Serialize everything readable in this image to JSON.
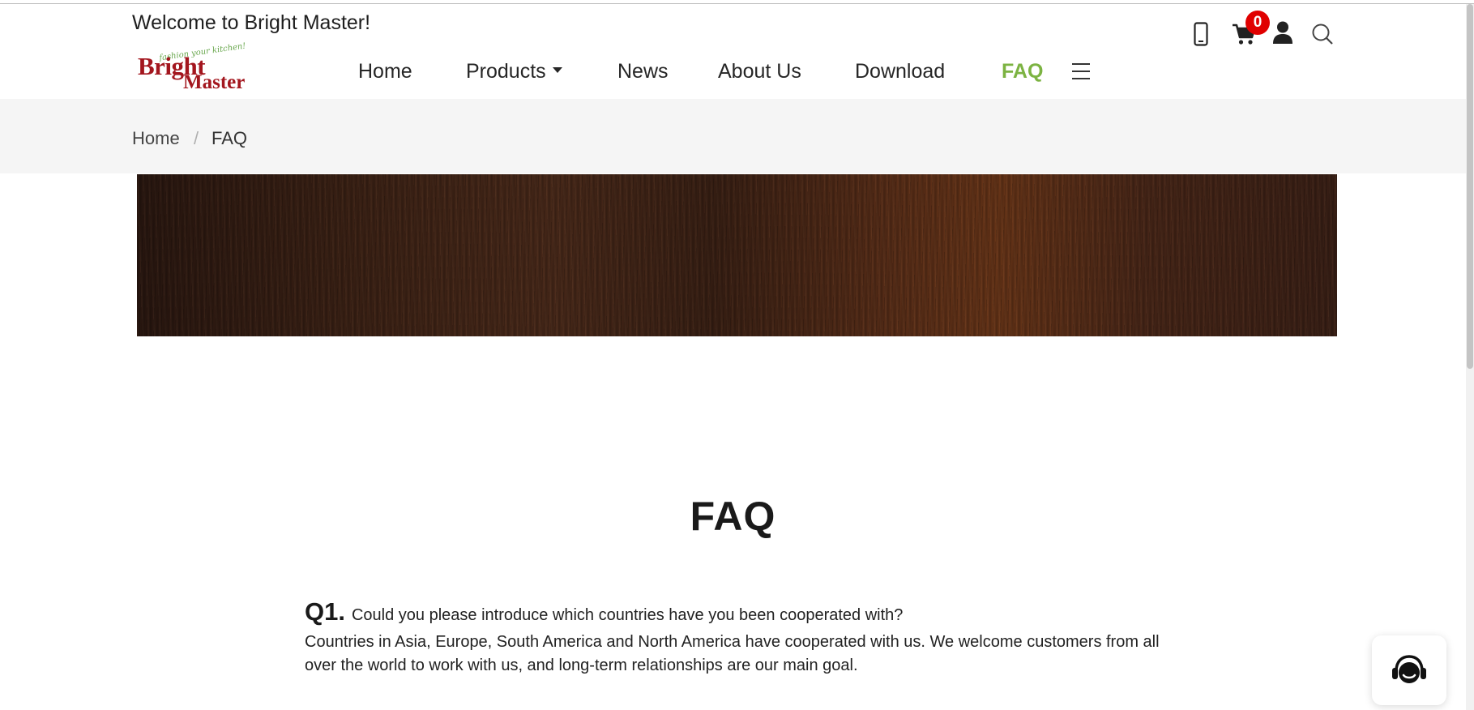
{
  "header": {
    "welcome_text": "Welcome to Bright Master!",
    "cart_count": "0",
    "icons": [
      "phone-icon",
      "cart-icon",
      "user-icon",
      "search-icon"
    ]
  },
  "logo": {
    "tagline": "fashion your kitchen!",
    "line1": "Bright",
    "line2": "Master"
  },
  "nav": {
    "items": [
      {
        "label": "Home"
      },
      {
        "label": "Products"
      },
      {
        "label": "News"
      },
      {
        "label": "About Us"
      },
      {
        "label": "Download"
      },
      {
        "label": "FAQ"
      }
    ],
    "active": "FAQ"
  },
  "breadcrumb": {
    "home": "Home",
    "separator": "/",
    "current": "FAQ"
  },
  "main": {
    "title": "FAQ",
    "faqs": [
      {
        "number": "Q1.",
        "question": "Could you please introduce which countries have you been cooperated with?",
        "answer": "Countries in Asia, Europe, South America and North America have cooperated with us. We welcome customers from all over the world to work with us, and long-term relationships are our main goal."
      }
    ]
  },
  "colors": {
    "accent_green": "#7cb342",
    "brand_red": "#a3161e",
    "badge_red": "#e00000"
  }
}
